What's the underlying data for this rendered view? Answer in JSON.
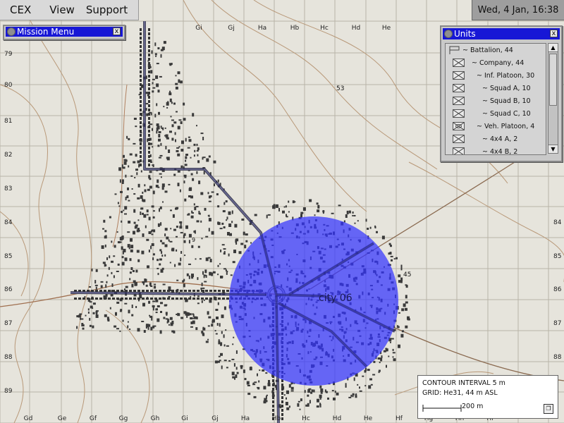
{
  "menubar": {
    "items": [
      "CEX",
      "View",
      "Support"
    ]
  },
  "clock": "Wed, 4 Jan, 16:38",
  "mission_menu": {
    "title": "Mission Menu",
    "close": "x"
  },
  "units_window": {
    "title": "Units",
    "close": "x",
    "items": [
      "~ Battalion, 44",
      "~ Company, 44",
      "~ Inf. Platoon, 30",
      "~ Squad A, 10",
      "~ Squad B, 10",
      "~ Squad C, 10",
      "~ Veh. Platoon, 4",
      "~ 4x4 A, 2",
      "~ 4x4 B, 2"
    ]
  },
  "map": {
    "grid_top": [
      "Gi",
      "Gj",
      "Ha",
      "Hb",
      "Hc",
      "Hd",
      "He"
    ],
    "grid_bottom": [
      "Gd",
      "Ge",
      "Gf",
      "Gg",
      "Gh",
      "Gi",
      "Gj",
      "Ha",
      "Hb",
      "Hc",
      "Hd",
      "He",
      "Hf",
      "Hg",
      "Hh",
      "Hi"
    ],
    "grid_left": [
      "79",
      "80",
      "81",
      "82",
      "83",
      "84",
      "85",
      "86",
      "87",
      "88",
      "89"
    ],
    "grid_right": [
      "84",
      "85",
      "86",
      "87",
      "88"
    ],
    "city_label": "city 06",
    "elevations": [
      "53",
      "45",
      "9"
    ],
    "overlay_color": "#3333ff"
  },
  "legend": {
    "contour": "CONTOUR INTERVAL 5 m",
    "grid": "GRID: He31, 44 m ASL",
    "scale": "200 m"
  }
}
